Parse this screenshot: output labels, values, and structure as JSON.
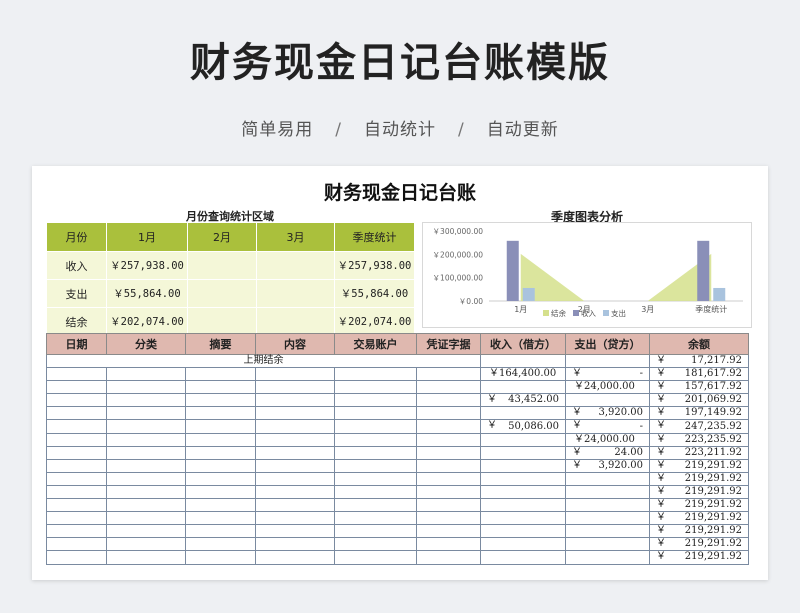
{
  "hero": {
    "title": "财务现金日记台账模版",
    "tags": [
      "简单易用",
      "自动统计",
      "自动更新"
    ],
    "separator": "/"
  },
  "sheet": {
    "title": "财务现金日记台账",
    "stats_caption": "月份查询统计区域",
    "chart_caption": "季度图表分析",
    "stats": {
      "headers": [
        "月份",
        "1月",
        "2月",
        "3月",
        "季度统计"
      ],
      "rows": [
        {
          "label": "收入",
          "values": [
            "￥257,938.00",
            "",
            "",
            "￥257,938.00"
          ]
        },
        {
          "label": "支出",
          "values": [
            "￥55,864.00",
            "",
            "",
            "￥55,864.00"
          ]
        },
        {
          "label": "结余",
          "values": [
            "￥202,074.00",
            "",
            "",
            "￥202,074.00"
          ]
        }
      ]
    },
    "ledger": {
      "headers": [
        "日期",
        "分类",
        "摘要",
        "内容",
        "交易账户",
        "凭证字据",
        "收入（借方）",
        "支出（贷方）",
        "余额"
      ],
      "opening_label": "上期结余",
      "currency": "￥",
      "rows": [
        {
          "income": "",
          "expense": "",
          "balance": "17,217.92",
          "opening": true
        },
        {
          "income": "￥164,400.00",
          "expense": "-",
          "balance": "181,617.92"
        },
        {
          "income": "",
          "expense": "￥24,000.00",
          "balance": "157,617.92"
        },
        {
          "income": "43,452.00",
          "expense": "",
          "balance": "201,069.92"
        },
        {
          "income": "",
          "expense": "3,920.00",
          "balance": "197,149.92"
        },
        {
          "income": "50,086.00",
          "expense": "-",
          "balance": "247,235.92"
        },
        {
          "income": "",
          "expense": "￥24,000.00",
          "balance": "223,235.92"
        },
        {
          "income": "",
          "expense": "24.00",
          "balance": "223,211.92"
        },
        {
          "income": "",
          "expense": "3,920.00",
          "balance": "219,291.92"
        },
        {
          "income": "",
          "expense": "",
          "balance": "219,291.92"
        },
        {
          "income": "",
          "expense": "",
          "balance": "219,291.92"
        },
        {
          "income": "",
          "expense": "",
          "balance": "219,291.92"
        },
        {
          "income": "",
          "expense": "",
          "balance": "219,291.92"
        },
        {
          "income": "",
          "expense": "",
          "balance": "219,291.92"
        },
        {
          "income": "",
          "expense": "",
          "balance": "219,291.92"
        },
        {
          "income": "",
          "expense": "",
          "balance": "219,291.92"
        }
      ]
    }
  },
  "chart_data": {
    "type": "bar",
    "categories": [
      "1月",
      "2月",
      "3月",
      "季度统计"
    ],
    "series": [
      {
        "name": "结余",
        "kind": "area",
        "color": "#d5e08c",
        "values": [
          202074,
          0,
          0,
          202074
        ]
      },
      {
        "name": "收入",
        "kind": "bar",
        "color": "#8a8fb8",
        "values": [
          257938,
          0,
          0,
          257938
        ]
      },
      {
        "name": "支出",
        "kind": "bar",
        "color": "#a9c3de",
        "values": [
          55864,
          0,
          0,
          55864
        ]
      }
    ],
    "yticks": [
      "￥300,000.00",
      "￥200,000.00",
      "￥100,000.00",
      "￥0.00"
    ],
    "ylim": [
      0,
      300000
    ],
    "legend": "bottom"
  }
}
